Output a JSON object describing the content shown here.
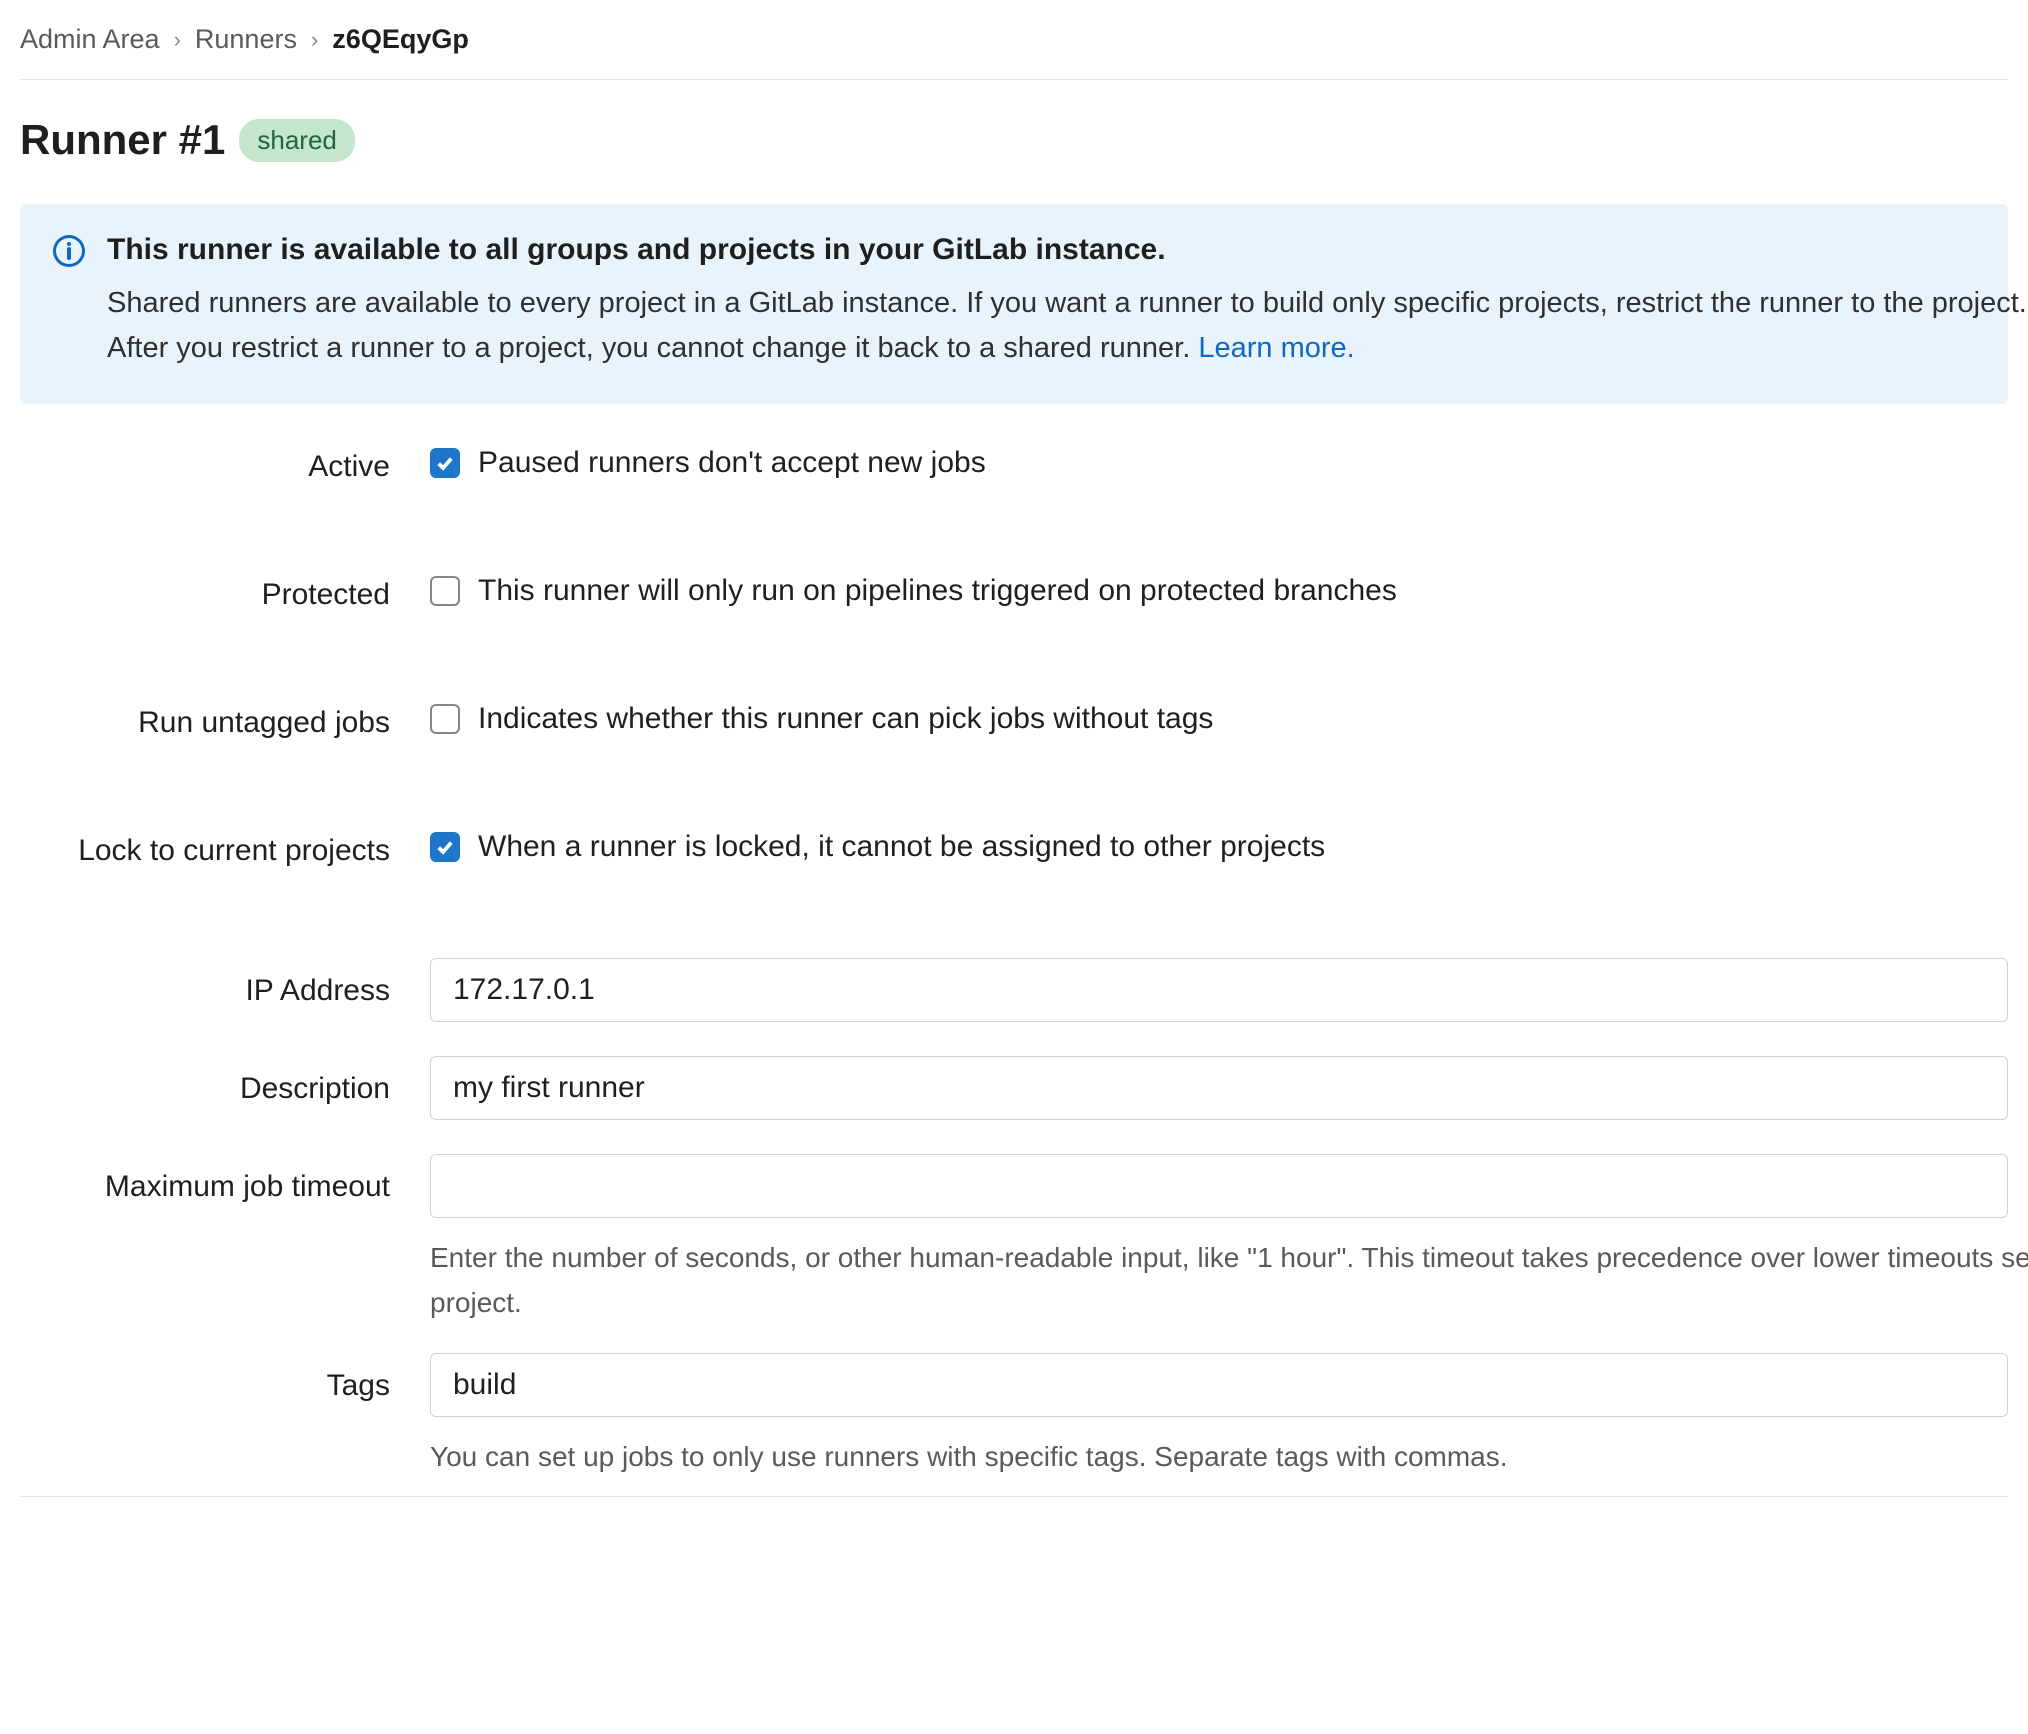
{
  "breadcrumbs": {
    "items": [
      "Admin Area",
      "Runners"
    ],
    "current": "z6QEqyGp"
  },
  "header": {
    "title": "Runner #1",
    "badge_label": "shared"
  },
  "alert": {
    "title": "This runner is available to all groups and projects in your GitLab instance.",
    "line1": "Shared runners are available to every project in a GitLab instance. If you want a runner to build only specific projects, restrict the runner to the project.",
    "line2_prefix": "After you restrict a runner to a project, you cannot change it back to a shared runner. ",
    "learn_more": "Learn more."
  },
  "form": {
    "active": {
      "label": "Active",
      "checked": true,
      "description": "Paused runners don't accept new jobs"
    },
    "protected": {
      "label": "Protected",
      "checked": false,
      "description": "This runner will only run on pipelines triggered on protected branches"
    },
    "run_untagged": {
      "label": "Run untagged jobs",
      "checked": false,
      "description": "Indicates whether this runner can pick jobs without tags"
    },
    "lock": {
      "label": "Lock to current projects",
      "checked": true,
      "description": "When a runner is locked, it cannot be assigned to other projects"
    },
    "ip": {
      "label": "IP Address",
      "value": "172.17.0.1"
    },
    "description": {
      "label": "Description",
      "value": "my first runner"
    },
    "timeout": {
      "label": "Maximum job timeout",
      "value": "",
      "help_line1": "Enter the number of seconds, or other human-readable input, like \"1 hour\". This timeout takes precedence over lower timeouts set for the",
      "help_line2": "project."
    },
    "tags": {
      "label": "Tags",
      "value": "build",
      "help": "You can set up jobs to only use runners with specific tags. Separate tags with commas."
    }
  },
  "colors": {
    "accent": "#1f75cb",
    "link": "#1068bf",
    "badge_bg": "#c3e6cd",
    "badge_fg": "#24663b",
    "alert_bg": "#e9f3fc"
  }
}
